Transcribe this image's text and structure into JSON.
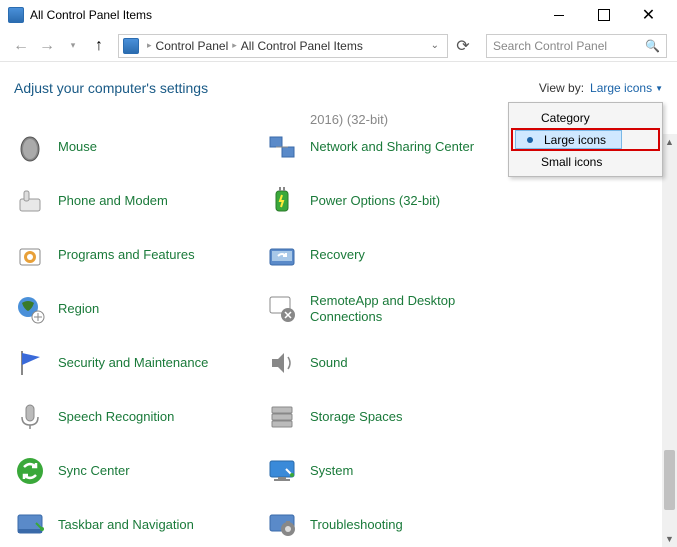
{
  "titleBar": {
    "title": "All Control Panel Items"
  },
  "breadcrumb": {
    "root": "Control Panel",
    "current": "All Control Panel Items"
  },
  "search": {
    "placeholder": "Search Control Panel"
  },
  "header": {
    "heading": "Adjust your computer's settings",
    "viewByLabel": "View by:",
    "viewByValue": "Large icons"
  },
  "cutItem": "2016) (32-bit)",
  "items": {
    "col1": [
      {
        "label": "Mouse"
      },
      {
        "label": "Phone and Modem"
      },
      {
        "label": "Programs and Features"
      },
      {
        "label": "Region"
      },
      {
        "label": "Security and Maintenance"
      },
      {
        "label": "Speech Recognition"
      },
      {
        "label": "Sync Center"
      },
      {
        "label": "Taskbar and Navigation"
      }
    ],
    "col2": [
      {
        "label": "Network and Sharing Center"
      },
      {
        "label": "Power Options (32-bit)"
      },
      {
        "label": "Recovery"
      },
      {
        "label": "RemoteApp and Desktop Connections"
      },
      {
        "label": "Sound"
      },
      {
        "label": "Storage Spaces"
      },
      {
        "label": "System"
      },
      {
        "label": "Troubleshooting"
      }
    ]
  },
  "dropdown": {
    "items": [
      {
        "label": "Category"
      },
      {
        "label": "Large icons",
        "selected": true
      },
      {
        "label": "Small icons"
      }
    ]
  }
}
